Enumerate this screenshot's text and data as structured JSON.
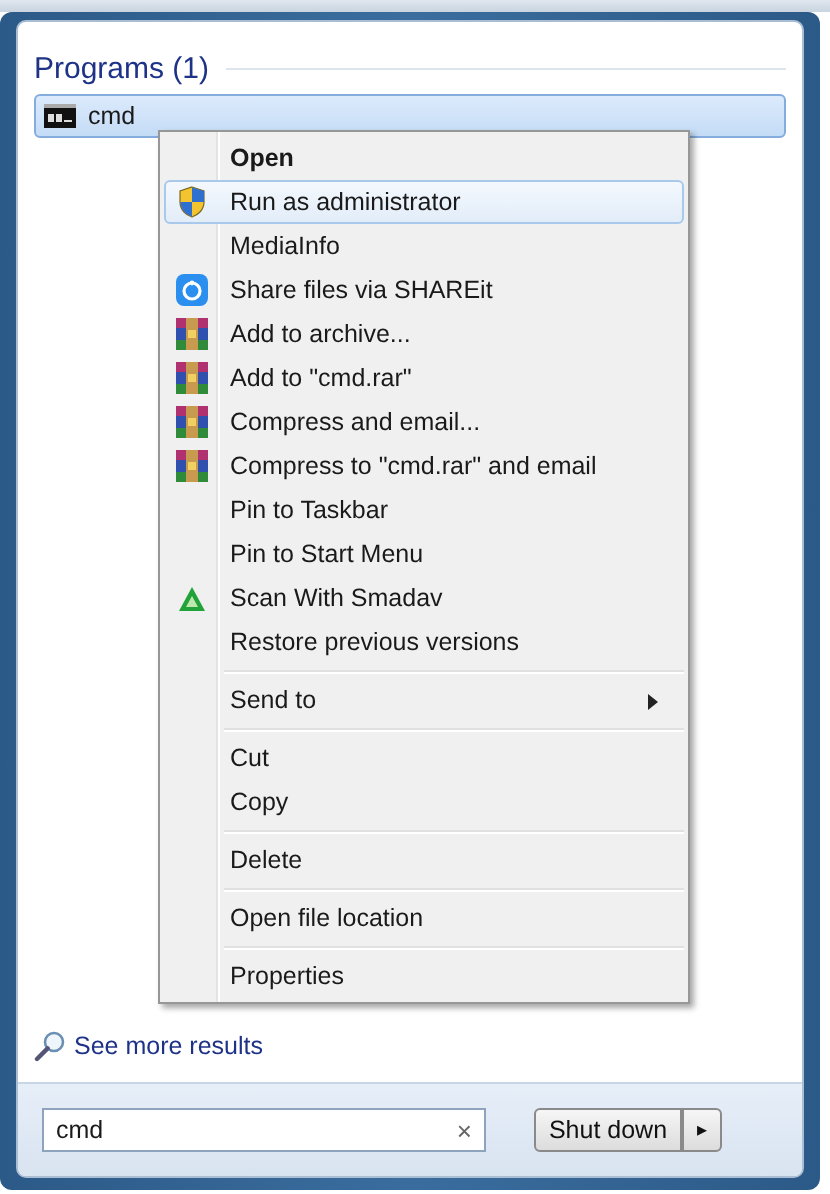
{
  "programs": {
    "heading": "Programs (1)",
    "items": [
      {
        "label": "cmd",
        "selected": true
      }
    ]
  },
  "context_menu": {
    "groups": [
      [
        {
          "label": "Open",
          "kind": "none",
          "default": true,
          "submenu": false,
          "selected": false
        },
        {
          "label": "Run as administrator",
          "kind": "shield",
          "default": false,
          "submenu": false,
          "selected": true
        },
        {
          "label": "MediaInfo",
          "kind": "none",
          "default": false,
          "submenu": false,
          "selected": false
        },
        {
          "label": "Share files via SHAREit",
          "kind": "shareit",
          "default": false,
          "submenu": false,
          "selected": false
        },
        {
          "label": "Add to archive...",
          "kind": "archive",
          "default": false,
          "submenu": false,
          "selected": false
        },
        {
          "label": "Add to \"cmd.rar\"",
          "kind": "archive",
          "default": false,
          "submenu": false,
          "selected": false
        },
        {
          "label": "Compress and email...",
          "kind": "archive",
          "default": false,
          "submenu": false,
          "selected": false
        },
        {
          "label": "Compress to \"cmd.rar\" and email",
          "kind": "archive",
          "default": false,
          "submenu": false,
          "selected": false
        },
        {
          "label": "Pin to Taskbar",
          "kind": "none",
          "default": false,
          "submenu": false,
          "selected": false
        },
        {
          "label": "Pin to Start Menu",
          "kind": "none",
          "default": false,
          "submenu": false,
          "selected": false
        },
        {
          "label": "Scan With Smadav",
          "kind": "smadav",
          "default": false,
          "submenu": false,
          "selected": false
        },
        {
          "label": "Restore previous versions",
          "kind": "none",
          "default": false,
          "submenu": false,
          "selected": false
        }
      ],
      [
        {
          "label": "Send to",
          "kind": "none",
          "default": false,
          "submenu": true,
          "selected": false
        }
      ],
      [
        {
          "label": "Cut",
          "kind": "none",
          "default": false,
          "submenu": false,
          "selected": false
        },
        {
          "label": "Copy",
          "kind": "none",
          "default": false,
          "submenu": false,
          "selected": false
        }
      ],
      [
        {
          "label": "Delete",
          "kind": "none",
          "default": false,
          "submenu": false,
          "selected": false
        }
      ],
      [
        {
          "label": "Open file location",
          "kind": "none",
          "default": false,
          "submenu": false,
          "selected": false
        }
      ],
      [
        {
          "label": "Properties",
          "kind": "none",
          "default": false,
          "submenu": false,
          "selected": false
        }
      ]
    ]
  },
  "see_more": "See more results",
  "search": {
    "value": "cmd",
    "clear": "×"
  },
  "shutdown": {
    "label": "Shut down",
    "arrow": "▸"
  }
}
